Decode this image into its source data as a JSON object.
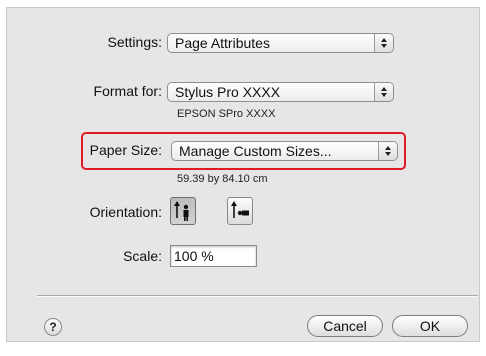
{
  "settings": {
    "label": "Settings:",
    "value": "Page Attributes"
  },
  "format_for": {
    "label": "Format for:",
    "value": "Stylus Pro XXXX",
    "subtext": "EPSON SPro XXXX"
  },
  "paper_size": {
    "label": "Paper Size:",
    "value": "Manage Custom Sizes...",
    "dimensions": "59.39 by 84.10 cm"
  },
  "orientation": {
    "label": "Orientation:",
    "options": [
      {
        "name": "portrait",
        "selected": true
      },
      {
        "name": "landscape",
        "selected": false
      }
    ]
  },
  "scale": {
    "label": "Scale:",
    "value": "100 %"
  },
  "buttons": {
    "help": "?",
    "cancel": "Cancel",
    "ok": "OK"
  },
  "colors": {
    "highlight": "#e01b24",
    "dialog_background": "#e6e6e6"
  }
}
